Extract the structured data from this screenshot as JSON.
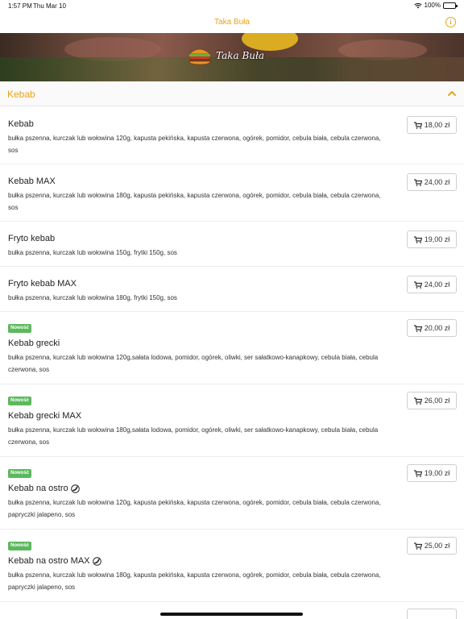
{
  "status": {
    "time": "1:57 PM",
    "date": "Thu Mar 10",
    "battery": "100%"
  },
  "nav": {
    "title": "Taka Buła"
  },
  "banner": {
    "logo_text": "Taka Buła"
  },
  "section": {
    "title": "Kebab"
  },
  "items": [
    {
      "name": "Kebab",
      "desc": "bułka pszenna, kurczak lub wołowina 120g, kapusta pekińska, kapusta czerwona, ogórek, pomidor, cebula biała, cebula czerwona, sos",
      "price": "18,00 zł",
      "badge": ""
    },
    {
      "name": "Kebab MAX",
      "desc": "bułka pszenna, kurczak lub wołowina 180g, kapusta pekińska, kapusta czerwona, ogórek, pomidor, cebula biała, cebula czerwona, sos",
      "price": "24,00 zł",
      "badge": ""
    },
    {
      "name": "Fryto kebab",
      "desc": "bułka pszenna, kurczak lub wołowina 150g, frytki 150g, sos",
      "price": "19,00 zł",
      "badge": ""
    },
    {
      "name": "Fryto kebab MAX",
      "desc": "bułka pszenna, kurczak lub wołowina 180g, frytki 150g, sos",
      "price": "24,00 zł",
      "badge": ""
    },
    {
      "name": "Kebab grecki",
      "desc": "bułka pszenna, kurczak lub wołowina 120g,sałata lodowa, pomidor, ogórek, oliwki, ser sałatkowo-kanapkowy, cebula biała, cebula czerwona, sos",
      "price": "20,00 zł",
      "badge": "Nowość"
    },
    {
      "name": "Kebab grecki MAX",
      "desc": "bułka pszenna, kurczak lub wołowina 180g,sałata lodowa, pomidor, ogórek, oliwki, ser sałatkowo-kanapkowy, cebula biała, cebula czerwona, sos",
      "price": "26,00 zł",
      "badge": "Nowość"
    },
    {
      "name": "Kebab na ostro",
      "desc": "bułka pszenna, kurczak lub wołowina 120g, kapusta pekińska, kapusta czerwona, ogórek, pomidor, cebula biała, cebula czerwona, papryczki jalapeno, sos",
      "price": "19,00 zł",
      "badge": "Nowość"
    },
    {
      "name": "Kebab na ostro MAX",
      "desc": "bułka pszenna, kurczak lub wołowina 180g, kapusta pekińska, kapusta czerwona, ogórek, pomidor, cebula biała, cebula czerwona, papryczki jalapeno, sos",
      "price": "25,00 zł",
      "badge": "Nowość"
    }
  ],
  "colors": {
    "accent": "#e8a317",
    "badge": "#5cb85c"
  },
  "icons": {
    "cart": "cart-icon",
    "spicy": "spicy-icon",
    "info": "info-icon",
    "collapse": "chevron-up-icon"
  }
}
